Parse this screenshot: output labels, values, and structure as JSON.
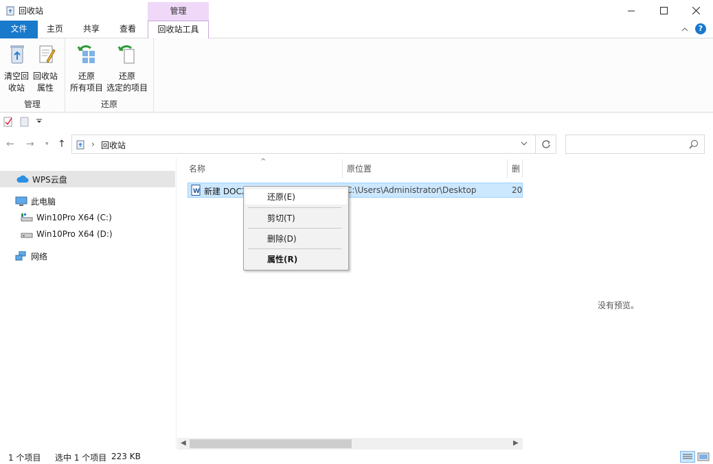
{
  "window": {
    "title": "回收站",
    "contextual_group": "管理"
  },
  "tabs": {
    "file": "文件",
    "home": "主页",
    "share": "共享",
    "view": "查看",
    "recycle_tools": "回收站工具"
  },
  "ribbon": {
    "empty_line1": "清空回",
    "empty_line2": "收站",
    "props_line1": "回收站",
    "props_line2": "属性",
    "group_manage": "管理",
    "restore_all_line1": "还原",
    "restore_all_line2": "所有项目",
    "restore_sel_line1": "还原",
    "restore_sel_line2": "选定的项目",
    "group_restore": "还原"
  },
  "address": {
    "path": "回收站",
    "search_placeholder": ""
  },
  "nav": {
    "wps": "WPS云盘",
    "this_pc": "此电脑",
    "drive_c": "Win10Pro X64 (C:)",
    "drive_d": "Win10Pro X64 (D:)",
    "network": "网络"
  },
  "columns": {
    "name": "名称",
    "location": "原位置",
    "deleted": "删除"
  },
  "file": {
    "name": "新建 DOCX",
    "location": "C:\\Users\\Administrator\\Desktop",
    "deleted": "20"
  },
  "preview": {
    "none": "没有预览。"
  },
  "context_menu": {
    "restore": "还原(E)",
    "cut": "剪切(T)",
    "delete": "删除(D)",
    "properties": "属性(R)"
  },
  "status": {
    "count": "1 个项目",
    "selection": "选中 1 个项目",
    "size": "223 KB"
  },
  "colors": {
    "accent": "#1979ca",
    "contextual_tab": "#f0d9f8",
    "selection": "#cce8ff"
  }
}
